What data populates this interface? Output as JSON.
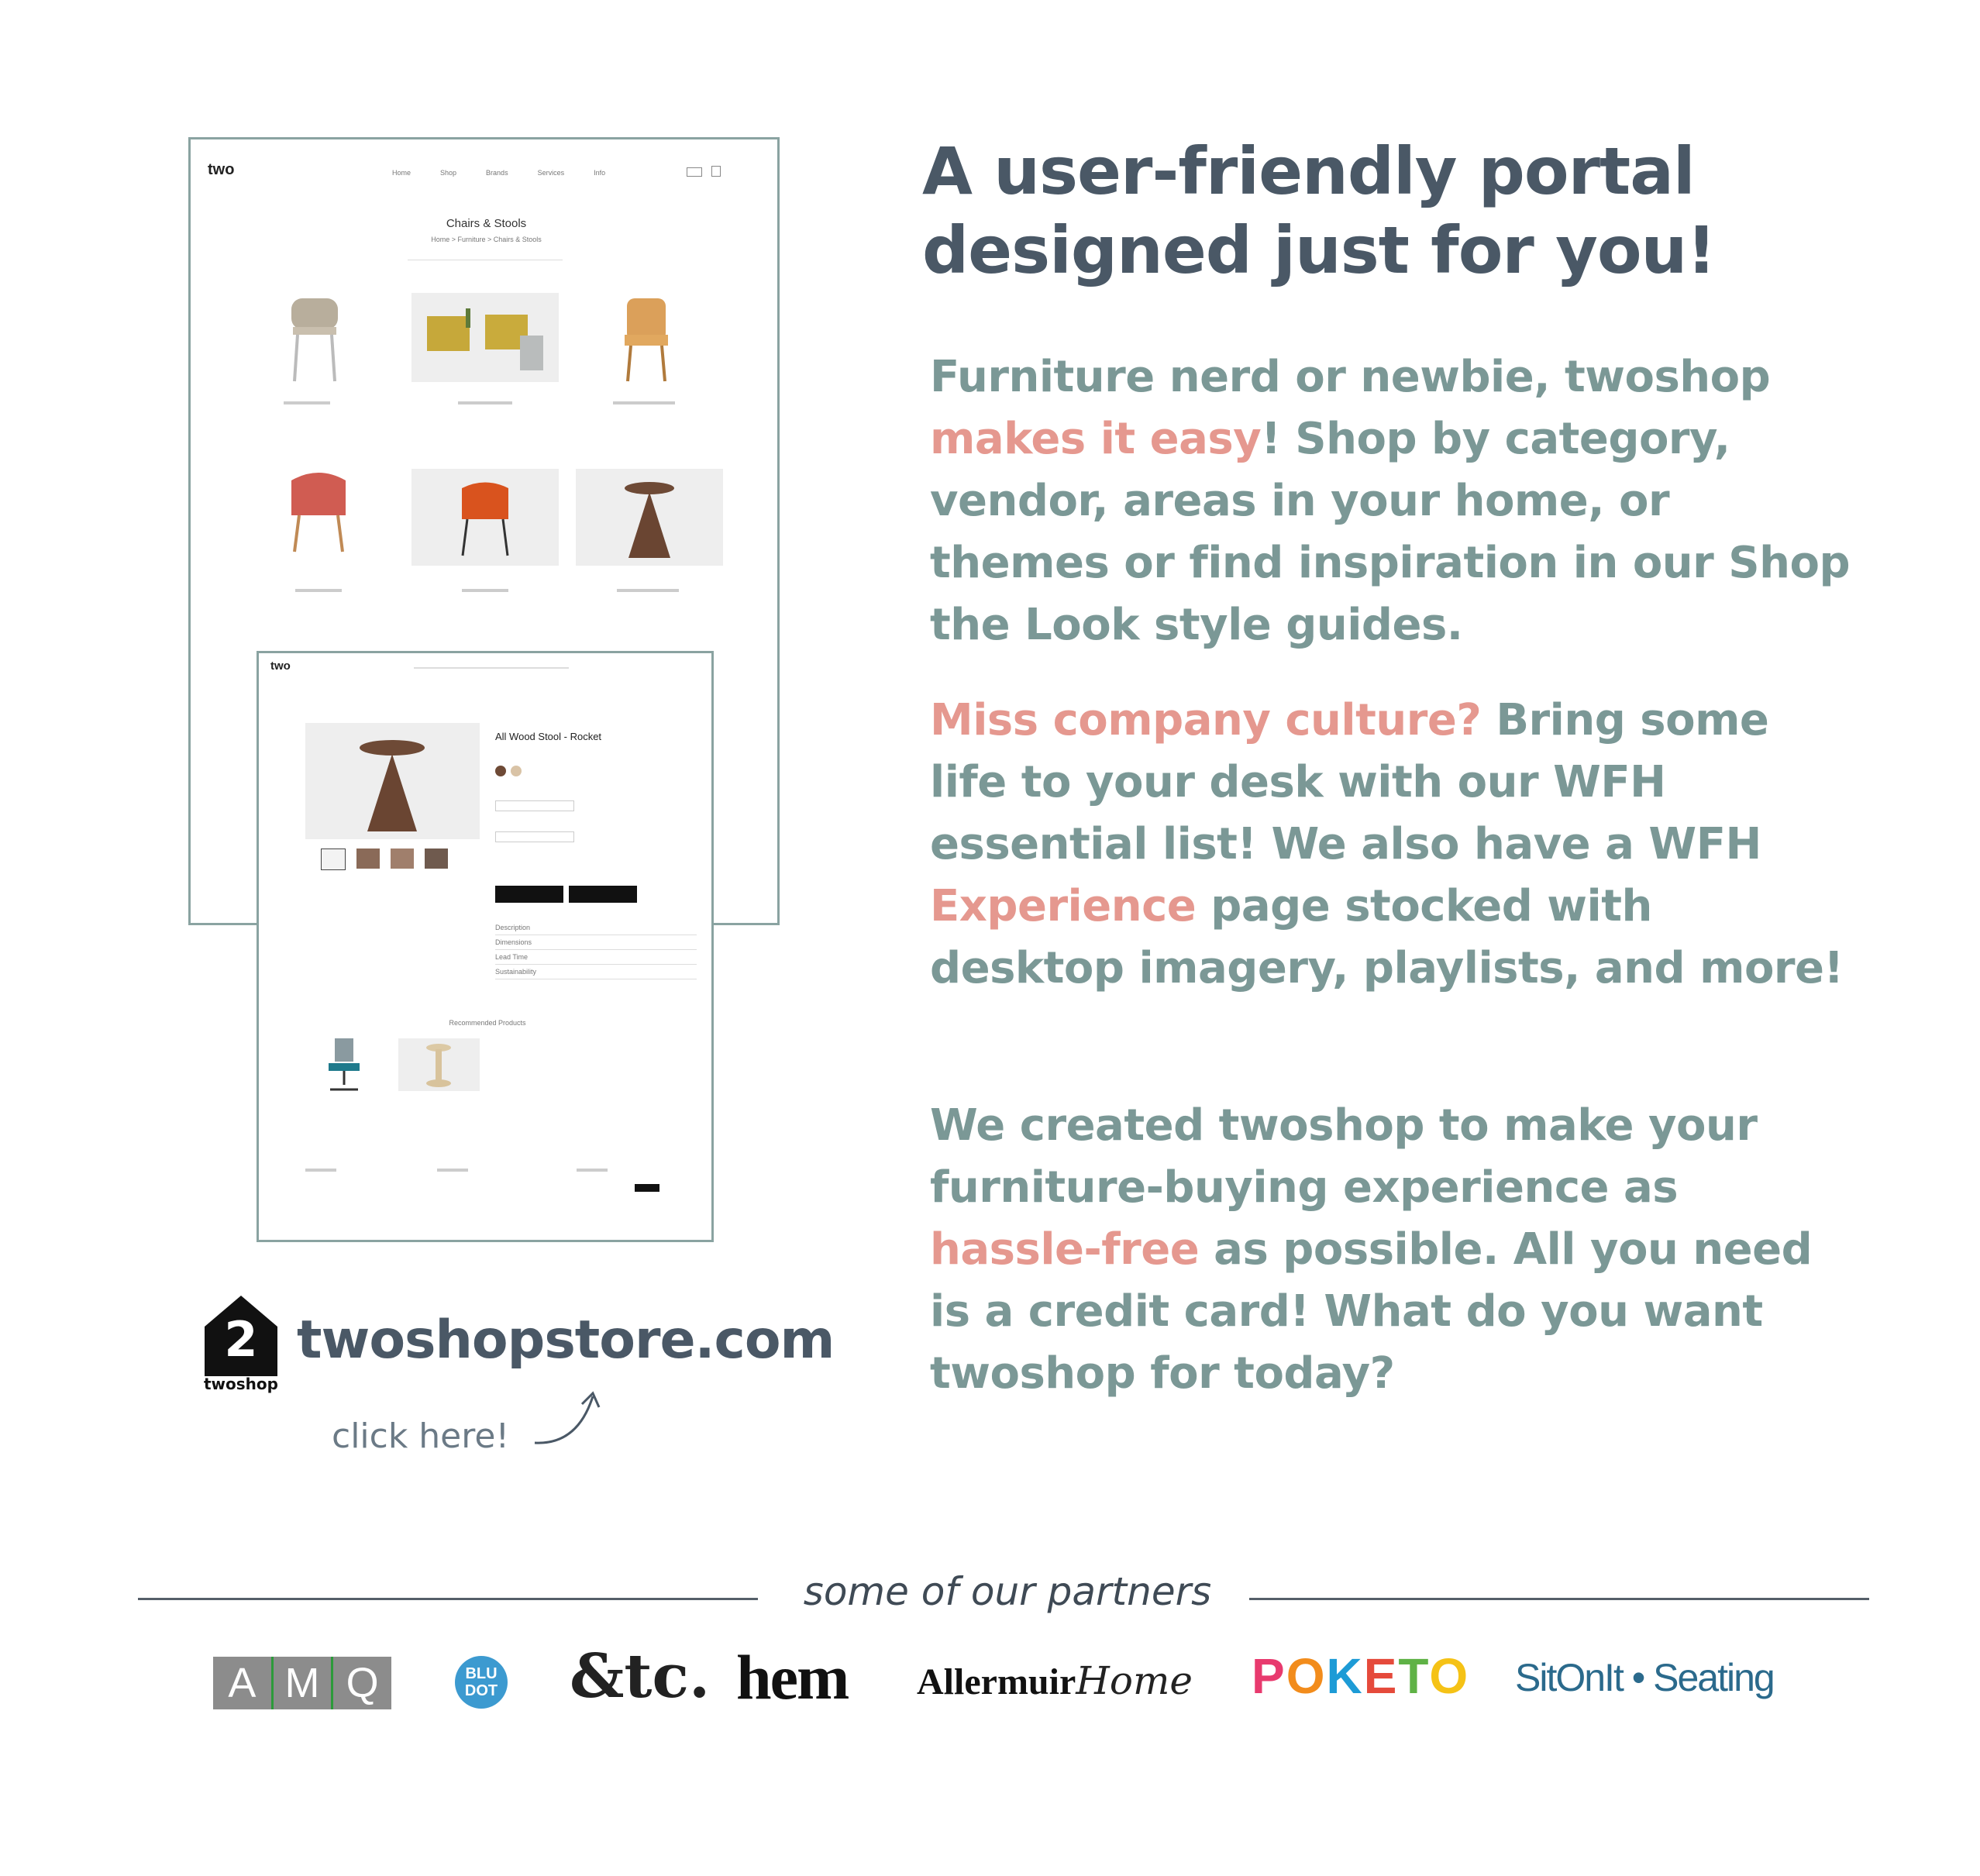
{
  "headline": {
    "line1": "A user-friendly portal",
    "line2": "designed just for you!"
  },
  "paragraph1": {
    "pre": "Furniture nerd or newbie, twoshop ",
    "highlight": "makes it easy",
    "post": "! Shop by category, vendor, areas in your home, or themes or find inspiration in our Shop the Look style guides."
  },
  "paragraph2": {
    "highlight1": "Miss company culture?",
    "mid1": " Bring some life to your desk with our WFH essential list! We also have a WFH ",
    "highlight2": "Experience",
    "post": " page stocked with desktop imagery, playlists, and more!"
  },
  "paragraph3": {
    "pre": "We created twoshop to make your furniture-buying experience as ",
    "highlight": "hassle-free",
    "post": " as possible. All you need is a credit card! What do you want twoshop for today?"
  },
  "brand": {
    "logo_number": "2",
    "logo_caption": "twoshop",
    "url": "twoshopstore.com",
    "click_here": "click here!"
  },
  "mockup_listing": {
    "logo": "two",
    "nav": [
      "Home",
      "Shop",
      "Brands",
      "Services",
      "Info"
    ],
    "title": "Chairs & Stools",
    "subtitle": "Home > Furniture > Chairs & Stools"
  },
  "mockup_product": {
    "logo": "two",
    "product_title": "All Wood Stool - Rocket",
    "recommended_title": "Recommended Products",
    "accordion": [
      "Description",
      "Dimensions",
      "Lead Time",
      "Sustainability"
    ]
  },
  "partners": {
    "title": "some of our partners",
    "logos": {
      "amq": [
        "A",
        "M",
        "Q"
      ],
      "bludot": [
        "BLU",
        "DOT"
      ],
      "etc": "&tc.",
      "hem": "hem",
      "allermuir_main": "Allermuir",
      "allermuir_script": "Home",
      "poketo": [
        "P",
        "O",
        "K",
        "E",
        "T",
        "O"
      ],
      "sitonit": "SitOnIt • Seating"
    }
  },
  "colors": {
    "headline": "#4a5866",
    "body": "#7b9896",
    "accent": "#e5988f",
    "frame_border": "#8aa3a1"
  }
}
